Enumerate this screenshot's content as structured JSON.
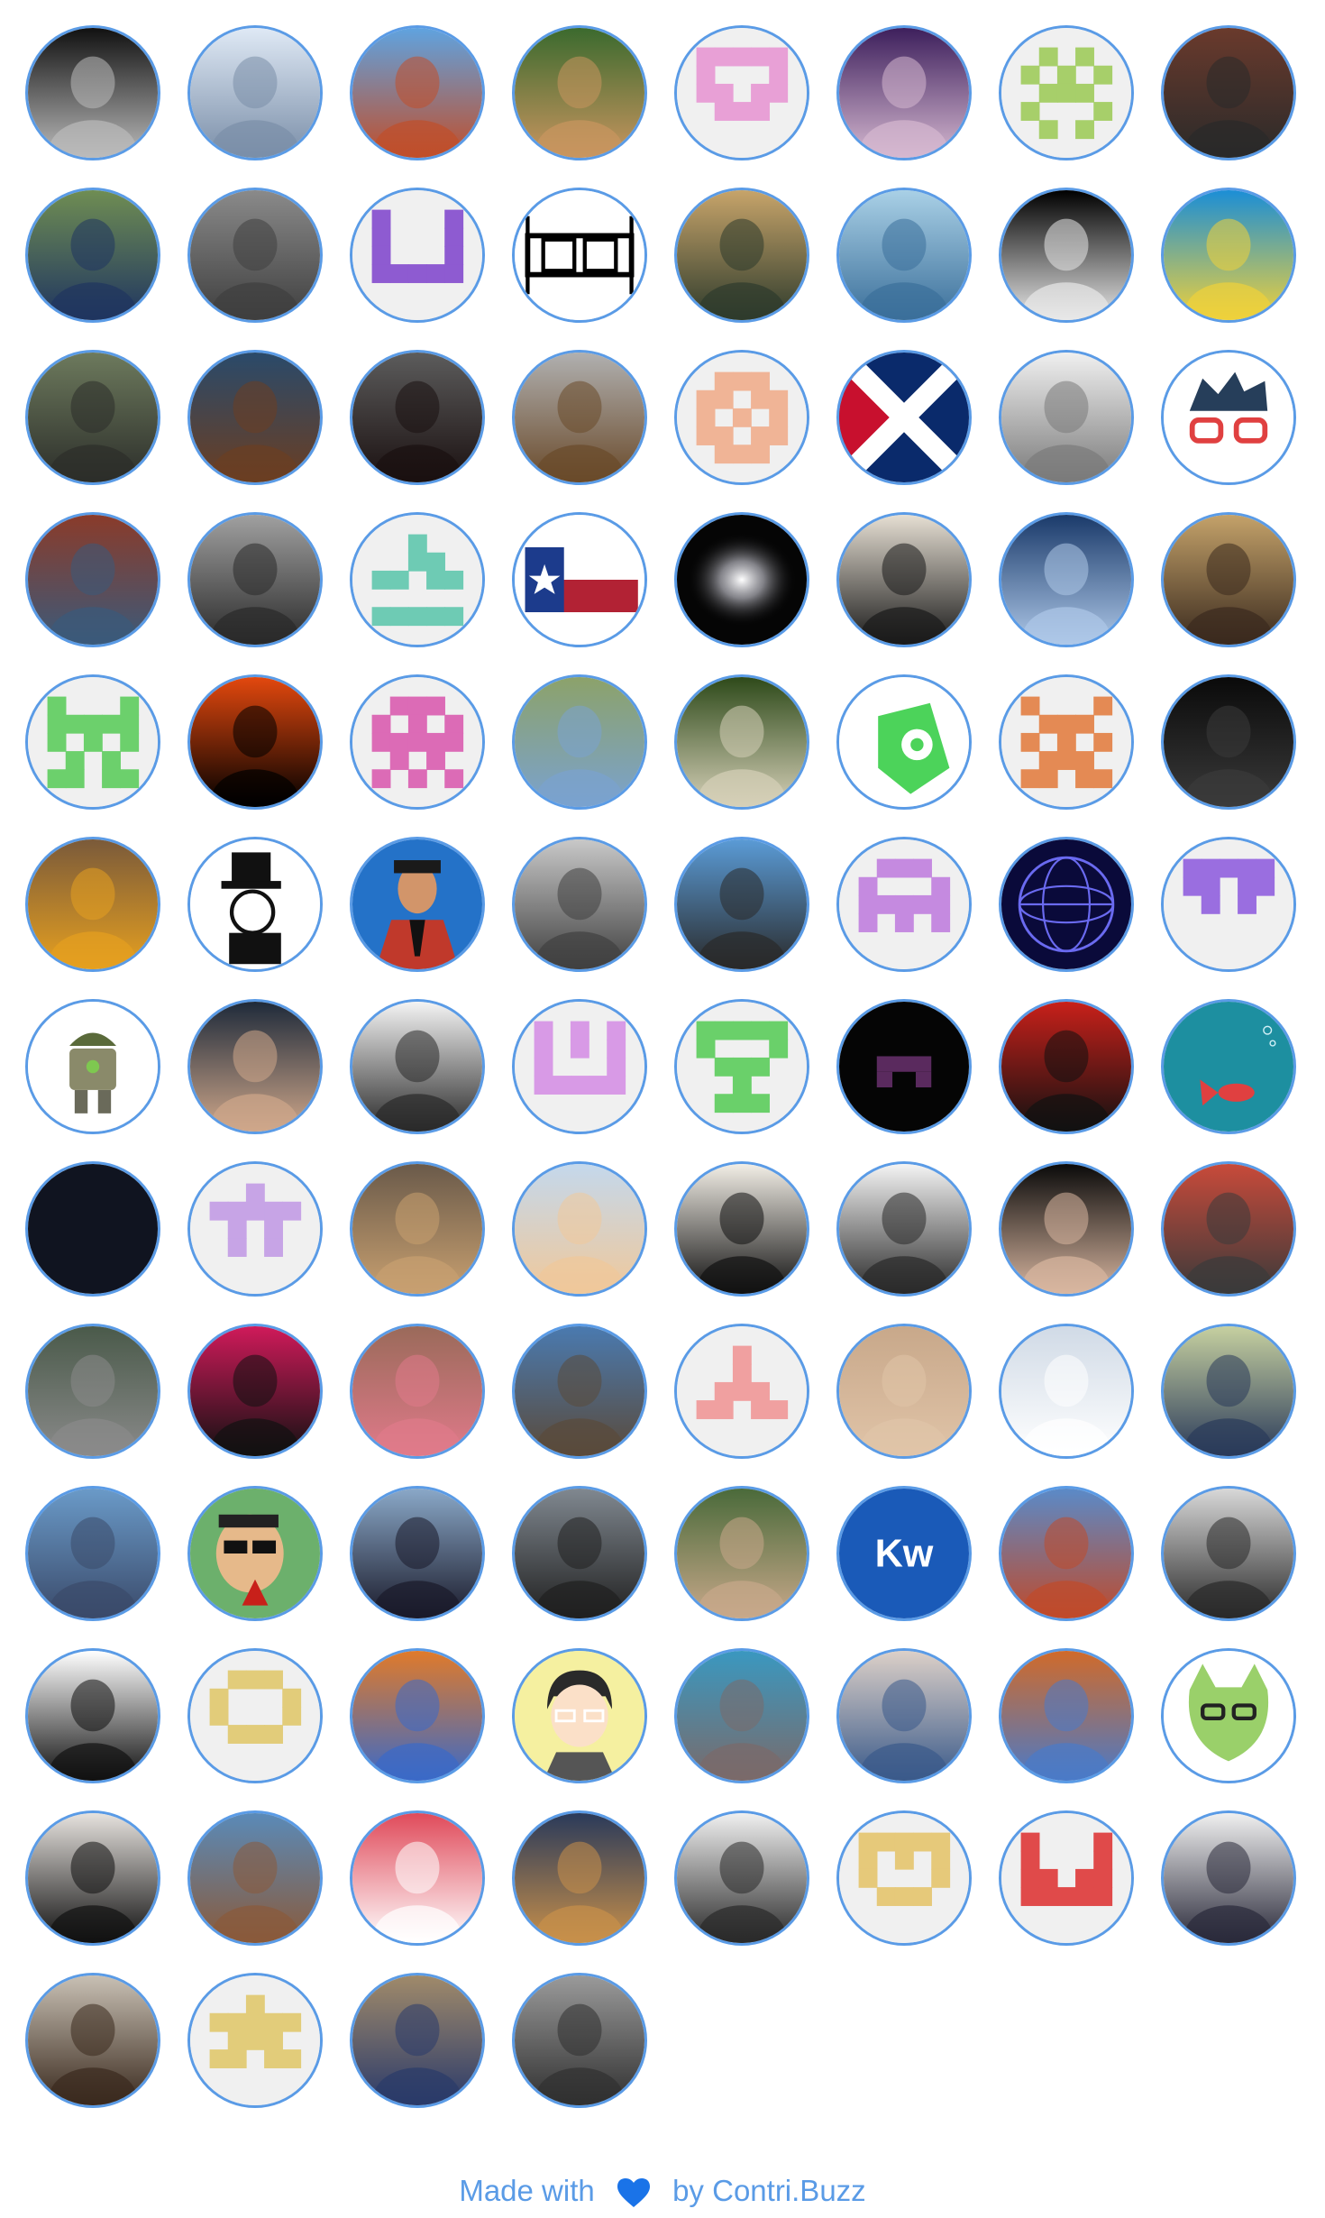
{
  "footer": {
    "made_with": "Made with",
    "by_text": "by",
    "brand": "Contri.Buzz",
    "heart_icon": "heart-icon",
    "heart_color": "#1a73e8"
  },
  "avatar_border_color": "#5a9be6",
  "avatars": [
    {
      "kind": "photo",
      "desc": "grayscale-portrait",
      "c": [
        "#111111",
        "#bbbbbb"
      ]
    },
    {
      "kind": "photo",
      "desc": "man-with-robot",
      "c": [
        "#dfe9f5",
        "#7a8ea8"
      ]
    },
    {
      "kind": "photo",
      "desc": "person-outdoor-sunny",
      "c": [
        "#5fa3e0",
        "#c14e2a"
      ]
    },
    {
      "kind": "photo",
      "desc": "man-with-pumpkin",
      "c": [
        "#3b6a2e",
        "#c9955f"
      ]
    },
    {
      "kind": "identicon",
      "c": [
        "#e8a0d6"
      ],
      "p": [
        [
          1,
          1,
          1,
          1,
          1
        ],
        [
          1,
          0,
          0,
          0,
          1
        ],
        [
          1,
          1,
          0,
          1,
          1
        ],
        [
          0,
          1,
          1,
          1,
          0
        ],
        [
          0,
          0,
          0,
          0,
          0
        ]
      ]
    },
    {
      "kind": "photo",
      "desc": "woman-purple-light",
      "c": [
        "#3d1f5c",
        "#d5b8d0"
      ]
    },
    {
      "kind": "identicon",
      "c": [
        "#a7cf6a"
      ],
      "p": [
        [
          0,
          1,
          0,
          1,
          0
        ],
        [
          1,
          0,
          1,
          0,
          1
        ],
        [
          0,
          1,
          1,
          1,
          0
        ],
        [
          1,
          0,
          0,
          0,
          1
        ],
        [
          0,
          1,
          0,
          1,
          0
        ]
      ]
    },
    {
      "kind": "photo",
      "desc": "man-with-beard-city",
      "c": [
        "#6a3a2c",
        "#2a2a2a"
      ]
    },
    {
      "kind": "photo",
      "desc": "man-in-suit",
      "c": [
        "#6f8d53",
        "#1f3560"
      ]
    },
    {
      "kind": "photo",
      "desc": "cat-upside-down",
      "c": [
        "#8a8a8a",
        "#3f3f3f"
      ]
    },
    {
      "kind": "identicon",
      "c": [
        "#8e5bd1"
      ],
      "p": [
        [
          1,
          0,
          0,
          0,
          1
        ],
        [
          1,
          0,
          0,
          0,
          1
        ],
        [
          1,
          0,
          0,
          0,
          1
        ],
        [
          1,
          1,
          1,
          1,
          1
        ],
        [
          0,
          0,
          0,
          0,
          0
        ]
      ]
    },
    {
      "kind": "logo-as",
      "c": [
        "#ffffff",
        "#000000"
      ]
    },
    {
      "kind": "photo",
      "desc": "smiling-man-orange",
      "c": [
        "#c7a46a",
        "#2e3b2c"
      ]
    },
    {
      "kind": "photo",
      "desc": "icy-swords",
      "c": [
        "#a9d0e6",
        "#3b6f9a"
      ]
    },
    {
      "kind": "photo",
      "desc": "anime-character-dark",
      "c": [
        "#000000",
        "#e8e8e8"
      ]
    },
    {
      "kind": "photo",
      "desc": "cartoon-pony",
      "c": [
        "#1b8ed6",
        "#f0d13a"
      ]
    },
    {
      "kind": "photo",
      "desc": "man-with-glasses",
      "c": [
        "#6d7a5d",
        "#2c2e2a"
      ]
    },
    {
      "kind": "photo",
      "desc": "man-curly-hair",
      "c": [
        "#2a4a6a",
        "#6b3e22"
      ]
    },
    {
      "kind": "photo",
      "desc": "long-hair-person",
      "c": [
        "#5c5c5c",
        "#1a1010"
      ]
    },
    {
      "kind": "photo",
      "desc": "bearded-man",
      "c": [
        "#b0b0b0",
        "#6a4a2a"
      ]
    },
    {
      "kind": "identicon",
      "c": [
        "#f0b496"
      ],
      "p": [
        [
          0,
          1,
          1,
          1,
          0
        ],
        [
          1,
          1,
          0,
          1,
          1
        ],
        [
          1,
          0,
          1,
          0,
          1
        ],
        [
          1,
          1,
          0,
          1,
          1
        ],
        [
          0,
          1,
          1,
          1,
          0
        ]
      ]
    },
    {
      "kind": "flag-scotland",
      "c": [
        "#c8102e",
        "#0a2a6b",
        "#ffffff"
      ]
    },
    {
      "kind": "photo",
      "desc": "bald-man-grayscale",
      "c": [
        "#f0f0f0",
        "#7a7a7a"
      ]
    },
    {
      "kind": "cartoon-glasses",
      "c": [
        "#ffffff",
        "#263e5a",
        "#e04040"
      ]
    },
    {
      "kind": "photo",
      "desc": "man-t-shirt-indoor",
      "c": [
        "#8a3b2a",
        "#3b5a7a"
      ]
    },
    {
      "kind": "photo",
      "desc": "man-grayscale",
      "c": [
        "#a0a0a0",
        "#2a2a2a"
      ]
    },
    {
      "kind": "identicon",
      "c": [
        "#6ecbb4"
      ],
      "p": [
        [
          0,
          0,
          1,
          0,
          0
        ],
        [
          0,
          0,
          1,
          1,
          0
        ],
        [
          1,
          1,
          0,
          1,
          1
        ],
        [
          0,
          0,
          0,
          0,
          0
        ],
        [
          1,
          1,
          1,
          1,
          1
        ]
      ]
    },
    {
      "kind": "texas-flag",
      "c": [
        "#ffffff",
        "#b22234",
        "#1c3b8c"
      ]
    },
    {
      "kind": "galaxy",
      "c": [
        "#050505",
        "#d6d6e0"
      ]
    },
    {
      "kind": "photo",
      "desc": "pirate-crow",
      "c": [
        "#e6dfd3",
        "#1a1a1a"
      ]
    },
    {
      "kind": "photo",
      "desc": "skeleton-computer",
      "c": [
        "#1a3a6a",
        "#aec8e8"
      ]
    },
    {
      "kind": "photo",
      "desc": "young-man-face",
      "c": [
        "#c4a26a",
        "#3a2a1e"
      ]
    },
    {
      "kind": "identicon",
      "c": [
        "#6cd06c"
      ],
      "p": [
        [
          1,
          0,
          0,
          0,
          1
        ],
        [
          1,
          1,
          1,
          1,
          1
        ],
        [
          1,
          0,
          1,
          0,
          1
        ],
        [
          0,
          1,
          0,
          1,
          0
        ],
        [
          1,
          1,
          0,
          1,
          1
        ]
      ]
    },
    {
      "kind": "photo",
      "desc": "silhouette-fire",
      "c": [
        "#e3480e",
        "#000000"
      ]
    },
    {
      "kind": "identicon",
      "c": [
        "#dc6bb6"
      ],
      "p": [
        [
          0,
          1,
          1,
          1,
          0
        ],
        [
          1,
          0,
          1,
          0,
          1
        ],
        [
          1,
          1,
          1,
          1,
          1
        ],
        [
          0,
          1,
          0,
          1,
          0
        ],
        [
          1,
          0,
          1,
          0,
          1
        ]
      ]
    },
    {
      "kind": "photo",
      "desc": "young-man-outdoor",
      "c": [
        "#8ca26a",
        "#7aa2cf"
      ]
    },
    {
      "kind": "photo",
      "desc": "man-in-forest",
      "c": [
        "#2e4a1a",
        "#d6d0b8"
      ]
    },
    {
      "kind": "alien-logo",
      "c": [
        "#ffffff",
        "#4cd35a"
      ]
    },
    {
      "kind": "identicon",
      "c": [
        "#e48a54"
      ],
      "p": [
        [
          1,
          0,
          0,
          0,
          1
        ],
        [
          0,
          1,
          1,
          1,
          0
        ],
        [
          1,
          0,
          1,
          0,
          1
        ],
        [
          0,
          1,
          1,
          1,
          0
        ],
        [
          1,
          1,
          0,
          1,
          1
        ]
      ]
    },
    {
      "kind": "photo",
      "desc": "masked-figure",
      "c": [
        "#0a0a0a",
        "#3a3a3a"
      ]
    },
    {
      "kind": "photo",
      "desc": "man-orange-shirt",
      "c": [
        "#7a5a3a",
        "#e6a020"
      ]
    },
    {
      "kind": "cartoon-hat",
      "c": [
        "#ffffff",
        "#111111"
      ]
    },
    {
      "kind": "cartoon-suit",
      "c": [
        "#2472c8",
        "#c0392b"
      ]
    },
    {
      "kind": "photo",
      "desc": "street-grayscale",
      "c": [
        "#c8c8c8",
        "#404040"
      ]
    },
    {
      "kind": "photo",
      "desc": "man-blue-sky",
      "c": [
        "#5a9bd6",
        "#2a2a2a"
      ]
    },
    {
      "kind": "identicon",
      "c": [
        "#c58ae0"
      ],
      "p": [
        [
          0,
          1,
          1,
          1,
          0
        ],
        [
          1,
          0,
          0,
          0,
          1
        ],
        [
          1,
          1,
          1,
          1,
          1
        ],
        [
          1,
          0,
          1,
          0,
          1
        ],
        [
          0,
          0,
          0,
          0,
          0
        ]
      ]
    },
    {
      "kind": "globe-wire",
      "c": [
        "#0a0a3a",
        "#6a6af0"
      ]
    },
    {
      "kind": "identicon",
      "c": [
        "#9a6ee0"
      ],
      "p": [
        [
          1,
          1,
          1,
          1,
          1
        ],
        [
          1,
          1,
          0,
          1,
          1
        ],
        [
          0,
          1,
          0,
          1,
          0
        ],
        [
          0,
          0,
          0,
          0,
          0
        ],
        [
          0,
          0,
          0,
          0,
          0
        ]
      ]
    },
    {
      "kind": "android-robot",
      "c": [
        "#ffffff",
        "#7ec850"
      ]
    },
    {
      "kind": "photo",
      "desc": "man-at-desk",
      "c": [
        "#1e2a3a",
        "#cfa78a"
      ]
    },
    {
      "kind": "photo",
      "desc": "man-formal-portrait",
      "c": [
        "#f4f4f4",
        "#2a2a2a"
      ]
    },
    {
      "kind": "identicon",
      "c": [
        "#d89ae6"
      ],
      "p": [
        [
          1,
          0,
          1,
          0,
          1
        ],
        [
          1,
          0,
          1,
          0,
          1
        ],
        [
          1,
          0,
          0,
          0,
          1
        ],
        [
          1,
          1,
          1,
          1,
          1
        ],
        [
          0,
          0,
          0,
          0,
          0
        ]
      ]
    },
    {
      "kind": "identicon",
      "c": [
        "#6ad06a"
      ],
      "p": [
        [
          1,
          1,
          1,
          1,
          1
        ],
        [
          1,
          0,
          0,
          0,
          1
        ],
        [
          0,
          1,
          1,
          1,
          0
        ],
        [
          0,
          0,
          1,
          0,
          0
        ],
        [
          0,
          1,
          1,
          1,
          0
        ]
      ]
    },
    {
      "kind": "dark-identicon",
      "c": [
        "#050505",
        "#5a2a5e"
      ]
    },
    {
      "kind": "photo",
      "desc": "anime-pirate",
      "c": [
        "#c8201a",
        "#111111"
      ]
    },
    {
      "kind": "fish",
      "c": [
        "#1d8fa0",
        "#e04040"
      ]
    },
    {
      "kind": "solid",
      "c": [
        "#101420"
      ]
    },
    {
      "kind": "identicon",
      "c": [
        "#c7a4e6"
      ],
      "p": [
        [
          0,
          0,
          1,
          0,
          0
        ],
        [
          1,
          1,
          1,
          1,
          1
        ],
        [
          0,
          1,
          0,
          1,
          0
        ],
        [
          0,
          1,
          0,
          1,
          0
        ],
        [
          0,
          0,
          0,
          0,
          0
        ]
      ]
    },
    {
      "kind": "photo",
      "desc": "kitten",
      "c": [
        "#6a5a4a",
        "#c8a070"
      ]
    },
    {
      "kind": "photo",
      "desc": "man-sunset",
      "c": [
        "#c4d8ec",
        "#f0c89a"
      ]
    },
    {
      "kind": "photo",
      "desc": "painted-face",
      "c": [
        "#f2eee6",
        "#111111"
      ]
    },
    {
      "kind": "photo",
      "desc": "man-portrait-white",
      "c": [
        "#f4f4f4",
        "#2a2a2a"
      ]
    },
    {
      "kind": "photo",
      "desc": "man-video-call",
      "c": [
        "#0a0a0a",
        "#d8b6a0"
      ]
    },
    {
      "kind": "photo",
      "desc": "man-graffiti",
      "c": [
        "#c84a3a",
        "#3a3a3a"
      ]
    },
    {
      "kind": "photo",
      "desc": "man-with-cap",
      "c": [
        "#4a5a4a",
        "#8a8a8a"
      ]
    },
    {
      "kind": "photo",
      "desc": "black-swan",
      "c": [
        "#d01a5a",
        "#111111"
      ]
    },
    {
      "kind": "photo",
      "desc": "pitbull-dog",
      "c": [
        "#9a6a5a",
        "#e07a8a"
      ]
    },
    {
      "kind": "photo",
      "desc": "man-mountains",
      "c": [
        "#4a7ab0",
        "#5a4a3a"
      ]
    },
    {
      "kind": "identicon",
      "c": [
        "#f0a0a0"
      ],
      "p": [
        [
          0,
          0,
          1,
          0,
          0
        ],
        [
          0,
          0,
          1,
          0,
          0
        ],
        [
          0,
          1,
          1,
          1,
          0
        ],
        [
          1,
          1,
          0,
          1,
          1
        ],
        [
          0,
          0,
          0,
          0,
          0
        ]
      ]
    },
    {
      "kind": "photo",
      "desc": "man-glasses-closeup",
      "c": [
        "#c8a88a",
        "#e0c4a8"
      ]
    },
    {
      "kind": "photo",
      "desc": "man-white-shirt",
      "c": [
        "#d0dae6",
        "#ffffff"
      ]
    },
    {
      "kind": "photo",
      "desc": "man-funny-face",
      "c": [
        "#c6d0a0",
        "#2a3a5a"
      ]
    },
    {
      "kind": "photo",
      "desc": "man-sunglasses-landscape",
      "c": [
        "#6a9ac8",
        "#3a4a6a"
      ]
    },
    {
      "kind": "cartoon-sunglasses",
      "c": [
        "#6cb06c",
        "#c8201a"
      ]
    },
    {
      "kind": "photo",
      "desc": "man-airport",
      "c": [
        "#8aa8c8",
        "#1a1a2a"
      ]
    },
    {
      "kind": "photo",
      "desc": "soldier-game",
      "c": [
        "#808890",
        "#202020"
      ]
    },
    {
      "kind": "photo",
      "desc": "smiling-man-green",
      "c": [
        "#4a6a3a",
        "#c8a88a"
      ]
    },
    {
      "kind": "kw-logo",
      "c": [
        "#1a5ab8",
        "#ffffff"
      ]
    },
    {
      "kind": "photo",
      "desc": "man-sunglasses-sky",
      "c": [
        "#5a8ac8",
        "#c04a2a"
      ]
    },
    {
      "kind": "photo",
      "desc": "man-glasses-light",
      "c": [
        "#d8d8d8",
        "#2a2a2a"
      ]
    },
    {
      "kind": "photo",
      "desc": "anime-black-white",
      "c": [
        "#ffffff",
        "#111111"
      ]
    },
    {
      "kind": "identicon",
      "c": [
        "#e2cc7a"
      ],
      "p": [
        [
          0,
          1,
          1,
          1,
          0
        ],
        [
          1,
          0,
          0,
          0,
          1
        ],
        [
          1,
          0,
          0,
          0,
          1
        ],
        [
          0,
          1,
          1,
          1,
          0
        ],
        [
          0,
          0,
          0,
          0,
          0
        ]
      ]
    },
    {
      "kind": "photo",
      "desc": "bird-painting",
      "c": [
        "#e07a2a",
        "#3a6ac8"
      ]
    },
    {
      "kind": "cartoon-face-yellow",
      "c": [
        "#f5f0a0",
        "#2a2a2a"
      ]
    },
    {
      "kind": "photo",
      "desc": "underwater-hippo",
      "c": [
        "#3a98c0",
        "#7a6a6a"
      ]
    },
    {
      "kind": "photo",
      "desc": "man-white-hair",
      "c": [
        "#dcd0c8",
        "#3a5a8a"
      ]
    },
    {
      "kind": "photo",
      "desc": "colorful-collage",
      "c": [
        "#d06a2a",
        "#4a7ac8"
      ]
    },
    {
      "kind": "cartoon-creature",
      "c": [
        "#9ad06a",
        "#ffffff"
      ]
    },
    {
      "kind": "photo",
      "desc": "young-man-dark-shirt",
      "c": [
        "#e6e2de",
        "#111111"
      ]
    },
    {
      "kind": "photo",
      "desc": "man-sunglasses-jacket",
      "c": [
        "#5a8ab8",
        "#8a5a3a"
      ]
    },
    {
      "kind": "photo",
      "desc": "anime-red-hair",
      "c": [
        "#e04a5a",
        "#ffffff"
      ]
    },
    {
      "kind": "photo",
      "desc": "cat-at-computer",
      "c": [
        "#2a3a5a",
        "#c8904a"
      ]
    },
    {
      "kind": "photo",
      "desc": "woman-grayscale",
      "c": [
        "#f0f0f0",
        "#2a2a2a"
      ]
    },
    {
      "kind": "identicon",
      "c": [
        "#e6c97a"
      ],
      "p": [
        [
          1,
          1,
          1,
          1,
          1
        ],
        [
          1,
          0,
          1,
          0,
          1
        ],
        [
          1,
          0,
          0,
          0,
          1
        ],
        [
          0,
          1,
          1,
          1,
          0
        ],
        [
          0,
          0,
          0,
          0,
          0
        ]
      ]
    },
    {
      "kind": "identicon",
      "c": [
        "#e04a4a"
      ],
      "p": [
        [
          1,
          0,
          0,
          0,
          1
        ],
        [
          1,
          0,
          0,
          0,
          1
        ],
        [
          1,
          1,
          0,
          1,
          1
        ],
        [
          1,
          1,
          1,
          1,
          1
        ],
        [
          0,
          0,
          0,
          0,
          0
        ]
      ]
    },
    {
      "kind": "photo",
      "desc": "man-smiling-beard",
      "c": [
        "#f0f0f0",
        "#2a2a3a"
      ]
    },
    {
      "kind": "photo",
      "desc": "woman-smiling",
      "c": [
        "#c8c0b4",
        "#3a2a1e"
      ]
    },
    {
      "kind": "identicon",
      "c": [
        "#e2cc7a"
      ],
      "p": [
        [
          0,
          0,
          1,
          0,
          0
        ],
        [
          1,
          1,
          1,
          1,
          1
        ],
        [
          0,
          1,
          1,
          1,
          0
        ],
        [
          1,
          1,
          0,
          1,
          1
        ],
        [
          0,
          0,
          0,
          0,
          0
        ]
      ]
    },
    {
      "kind": "photo",
      "desc": "man-speaking",
      "c": [
        "#a08a6a",
        "#2a3a6a"
      ]
    },
    {
      "kind": "photo",
      "desc": "blurred-face",
      "c": [
        "#9a9a9a",
        "#303030"
      ]
    }
  ]
}
